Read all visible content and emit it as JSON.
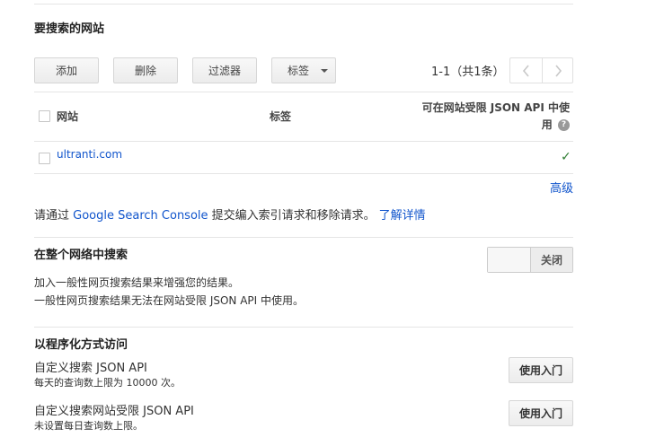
{
  "sites_section": {
    "title": "要搜索的网站",
    "buttons": {
      "add": "添加",
      "delete": "删除",
      "filter": "过滤器",
      "labels": "标签"
    },
    "pagination": "1-1（共1条）",
    "columns": {
      "site": "网站",
      "label": "标签",
      "restricted": "可在网站受限 JSON API 中使用"
    },
    "rows": [
      {
        "site": "ultranti.com",
        "label": "",
        "restricted_check": "✓"
      }
    ],
    "advanced_link": "高级"
  },
  "console_note": {
    "prefix": "请通过 ",
    "link": "Google Search Console",
    "middle": " 提交编入索引请求和移除请求。",
    "learn_more": "了解详情"
  },
  "web_search": {
    "title": "在整个网络中搜索",
    "toggle_state": "关闭",
    "desc_line1": "加入一般性网页搜索结果来增强您的结果。",
    "desc_line2": "一般性网页搜索结果无法在网站受限 JSON API 中使用。"
  },
  "programmatic": {
    "title": "以程序化方式访问",
    "apis": [
      {
        "name": "自定义搜索 JSON API",
        "note": "每天的查询数上限为 10000 次。",
        "button": "使用入门"
      },
      {
        "name": "自定义搜索网站受限 JSON API",
        "note": "未设置每日查询数上限。",
        "button": "使用入门"
      }
    ]
  },
  "colors": {
    "link": "#1155cc",
    "check": "#2e7d32"
  }
}
